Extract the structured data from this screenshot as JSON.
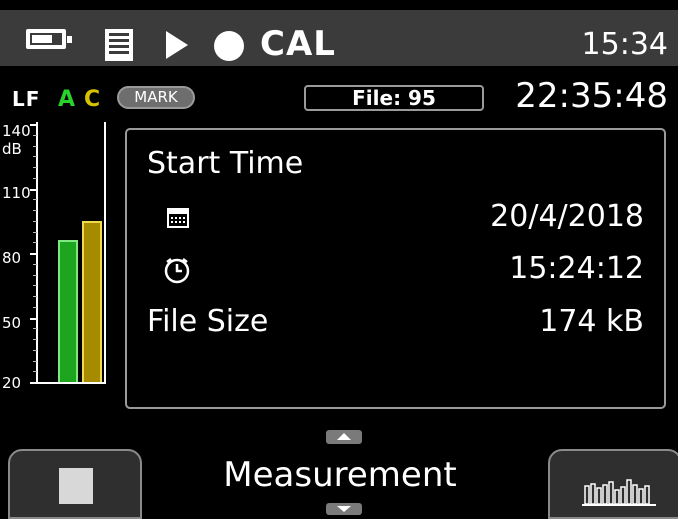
{
  "status_bar": {
    "battery_level": 0.7,
    "cal_label": "CAL",
    "clock": "15:34",
    "icons": [
      "battery-icon",
      "list-icon",
      "play-icon",
      "record-icon"
    ]
  },
  "header": {
    "weighting_lf": "LF",
    "weighting_a": "A",
    "weighting_c": "C",
    "mark_label": "MARK",
    "file_label": "File: 95",
    "elapsed": "22:35:48"
  },
  "meter": {
    "scale_labels": [
      "140",
      "dB",
      "110",
      "80",
      "50",
      "20"
    ],
    "scale_min": 20,
    "scale_max": 140,
    "a_level_db": 86,
    "c_level_db": 95,
    "colors": {
      "a": "#1ea51f",
      "c": "#a68b00"
    }
  },
  "info": {
    "start_time_label": "Start Time",
    "date_value": "20/4/2018",
    "time_value": "15:24:12",
    "file_size_label": "File Size",
    "file_size_value": "174 kB",
    "icons": [
      "calendar-icon",
      "clock-icon"
    ]
  },
  "footer": {
    "mode_label": "Measurement",
    "left_button_icon": "stop-icon",
    "right_button_icon": "bar-graph-icon"
  }
}
